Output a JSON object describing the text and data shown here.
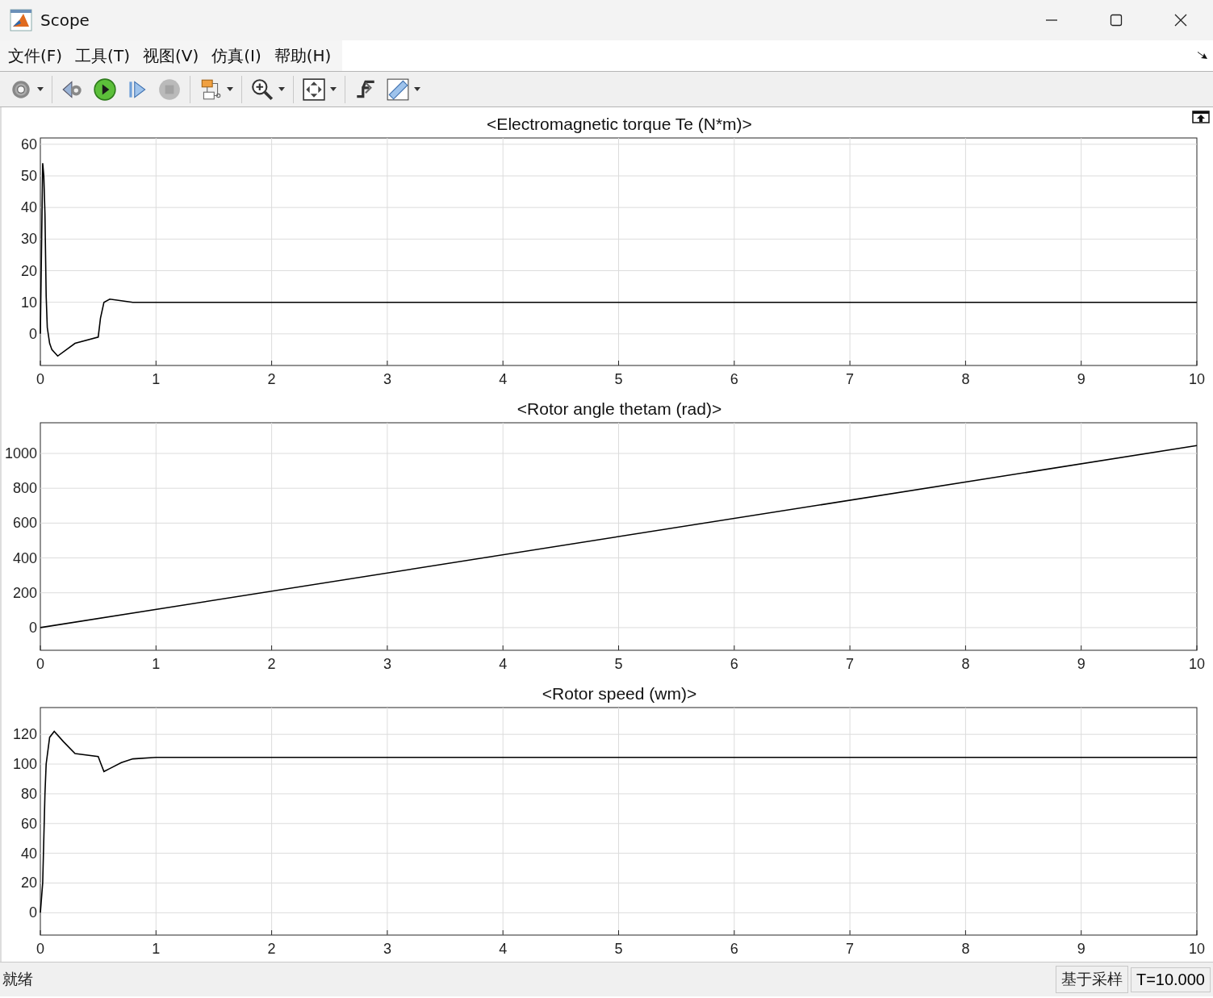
{
  "window": {
    "title": "Scope"
  },
  "menu": [
    {
      "label": "文件(F)"
    },
    {
      "label": "工具(T)"
    },
    {
      "label": "视图(V)"
    },
    {
      "label": "仿真(I)"
    },
    {
      "label": "帮助(H)"
    }
  ],
  "toolbar": [
    {
      "kind": "settings",
      "dropdown": true,
      "disabled": false
    },
    {
      "kind": "step-back",
      "dropdown": false,
      "disabled": false
    },
    {
      "kind": "run",
      "dropdown": false,
      "disabled": false
    },
    {
      "kind": "step-forward",
      "dropdown": false,
      "disabled": false
    },
    {
      "kind": "stop",
      "dropdown": false,
      "disabled": true
    },
    {
      "kind": "signals",
      "dropdown": true,
      "disabled": false
    },
    {
      "kind": "zoom",
      "dropdown": true,
      "disabled": false
    },
    {
      "kind": "fit",
      "dropdown": true,
      "disabled": false
    },
    {
      "kind": "trigger",
      "dropdown": false,
      "disabled": false
    },
    {
      "kind": "ruler",
      "dropdown": true,
      "disabled": false
    }
  ],
  "plots": [
    {
      "chart_data": {
        "type": "line",
        "title": "<Electromagnetic torque Te (N*m)>",
        "x": [
          0,
          0.02,
          0.03,
          0.04,
          0.05,
          0.06,
          0.08,
          0.1,
          0.15,
          0.3,
          0.5,
          0.52,
          0.55,
          0.6,
          0.7,
          0.8,
          1,
          10
        ],
        "values": [
          0,
          54,
          50,
          38,
          12,
          2,
          -3,
          -5,
          -7,
          -3,
          -1,
          5,
          10,
          11,
          10.5,
          10,
          10,
          10
        ],
        "xlim": [
          0,
          10
        ],
        "ylim": [
          -10,
          62
        ],
        "xticks": [
          0,
          1,
          2,
          3,
          4,
          5,
          6,
          7,
          8,
          9,
          10
        ],
        "yticks": [
          0,
          10,
          20,
          30,
          40,
          50,
          60
        ],
        "grid": true
      }
    },
    {
      "chart_data": {
        "type": "line",
        "title": "<Rotor angle thetam (rad)>",
        "x": [
          0,
          10
        ],
        "values": [
          0,
          1045
        ],
        "xlim": [
          0,
          10
        ],
        "ylim": [
          -130,
          1176
        ],
        "xticks": [
          0,
          1,
          2,
          3,
          4,
          5,
          6,
          7,
          8,
          9,
          10
        ],
        "yticks": [
          0,
          200,
          400,
          600,
          800,
          1000
        ],
        "grid": true
      }
    },
    {
      "chart_data": {
        "type": "line",
        "title": "<Rotor speed (wm)>",
        "x": [
          0,
          0.02,
          0.04,
          0.05,
          0.08,
          0.12,
          0.2,
          0.3,
          0.5,
          0.52,
          0.55,
          0.6,
          0.7,
          0.8,
          1,
          10
        ],
        "values": [
          0,
          20,
          80,
          100,
          118,
          122,
          115,
          107,
          105,
          101,
          95,
          97,
          101,
          103.5,
          104.5,
          104.5
        ],
        "xlim": [
          0,
          10
        ],
        "ylim": [
          -15,
          138
        ],
        "xticks": [
          0,
          1,
          2,
          3,
          4,
          5,
          6,
          7,
          8,
          9,
          10
        ],
        "yticks": [
          0,
          20,
          40,
          60,
          80,
          100,
          120
        ],
        "grid": true
      }
    }
  ],
  "status": {
    "message": "就绪",
    "mode": "基于采样",
    "time": "T=10.000"
  }
}
